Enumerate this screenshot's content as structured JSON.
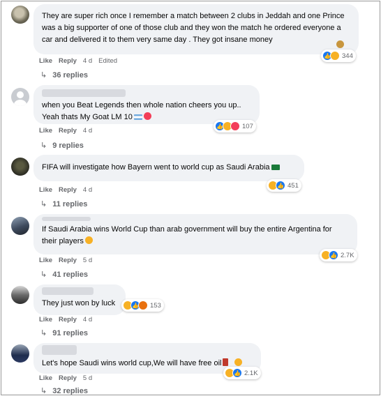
{
  "comments": [
    {
      "text": "They are super rich once I remember a match between 2 clubs in Jeddah and one Prince was a big supporter of one of those club and they won the match he ordered everyone a car and delivered it to them very same day . They got insane money",
      "emoji_end": "money-bag-icon",
      "like": "Like",
      "reply": "Reply",
      "time": "4 d",
      "edited": "Edited",
      "reaction_count": "344",
      "replies": "36 replies"
    },
    {
      "text": "when you Beat Legends then whole nation cheers you up..\nYeah thats My Goat LM 10",
      "emoji_end": "flag-heart-icon",
      "like": "Like",
      "reply": "Reply",
      "time": "4 d",
      "reaction_count": "107",
      "replies": "9 replies"
    },
    {
      "text": "FIFA will investigate how Bayern went to world cup as Saudi Arabia",
      "emoji_end": "saudi-flag-icon",
      "like": "Like",
      "reply": "Reply",
      "time": "4 d",
      "reaction_count": "451",
      "replies": "11 replies"
    },
    {
      "text": "If Saudi Arabia wins World Cup than arab government will buy the entire Argentina for their players",
      "emoji_end": "grin-icon",
      "like": "Like",
      "reply": "Reply",
      "time": "5 d",
      "reaction_count": "2.7K",
      "replies": "41 replies"
    },
    {
      "text": "They just won by luck",
      "emoji_end": "",
      "like": "Like",
      "reply": "Reply",
      "time": "4 d",
      "reaction_count": "153",
      "replies": "91 replies"
    },
    {
      "text": "Let's hope Saudi wins world cup,We will have free oil",
      "emoji_end": "oil-drum-grin-icon",
      "like": "Like",
      "reply": "Reply",
      "time": "5 d",
      "reaction_count": "2.1K",
      "replies": "32 replies"
    }
  ],
  "colors": {
    "bubble": "#f0f2f5",
    "muted": "#65676b",
    "like_blue": "#1877f2",
    "haha_yellow": "#f7b125",
    "love_red": "#f33e58"
  }
}
